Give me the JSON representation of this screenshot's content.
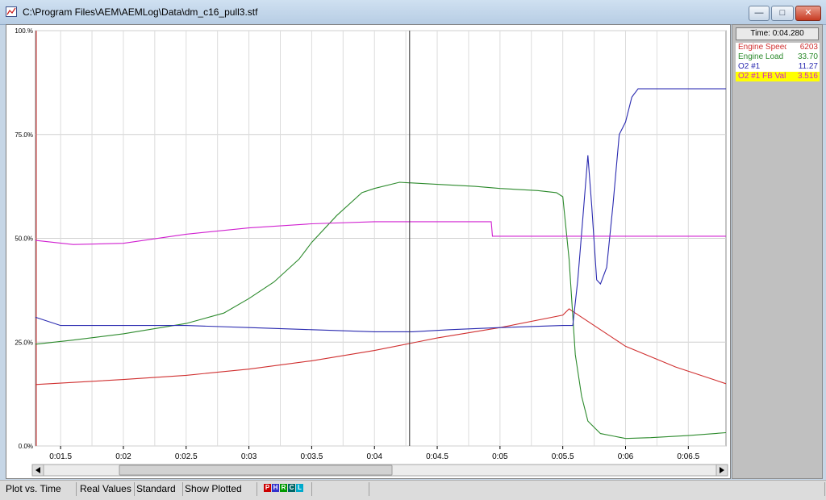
{
  "window": {
    "title": "C:\\Program Files\\AEM\\AEMLog\\Data\\dm_c16_pull3.stf"
  },
  "window_controls": {
    "minimize": "—",
    "maximize": "□",
    "close": "✕"
  },
  "chart_data": {
    "type": "line",
    "y_ticks": [
      "100.%",
      "75.0%",
      "50.0%",
      "25.0%",
      "0.0%"
    ],
    "x_ticks": [
      "0:01.5",
      "0:02",
      "0:02.5",
      "0:03",
      "0:03.5",
      "0:04",
      "0:04.5",
      "0:05",
      "0:05.5",
      "0:06",
      "0:06.5"
    ],
    "ylim": [
      0,
      100
    ],
    "xlim": [
      1.3,
      6.8
    ],
    "cursor_time": 4.28,
    "grid": true,
    "series": [
      {
        "name": "Engine Speed",
        "color": "#d03030",
        "x": [
          1.3,
          2.0,
          2.5,
          3.0,
          3.5,
          4.0,
          4.5,
          5.0,
          5.5,
          5.55,
          5.6,
          5.8,
          6.0,
          6.4,
          6.8
        ],
        "values": [
          14.8,
          16,
          17,
          18.5,
          20.5,
          23,
          26,
          28.5,
          31.5,
          33,
          32,
          28,
          24,
          19,
          15
        ]
      },
      {
        "name": "Engine Load",
        "color": "#2c8a2c",
        "x": [
          1.3,
          1.6,
          2.0,
          2.5,
          2.8,
          3.0,
          3.2,
          3.4,
          3.5,
          3.7,
          3.9,
          4.0,
          4.2,
          4.5,
          4.8,
          5.0,
          5.3,
          5.45,
          5.5,
          5.55,
          5.6,
          5.65,
          5.7,
          5.8,
          6.0,
          6.2,
          6.5,
          6.8
        ],
        "values": [
          24.5,
          25.5,
          27,
          29.5,
          32,
          35.5,
          39.5,
          45,
          49,
          55.5,
          61,
          62,
          63.5,
          63,
          62.5,
          62,
          61.5,
          61,
          60,
          45,
          22,
          12,
          6,
          3,
          1.8,
          2,
          2.5,
          3.2
        ]
      },
      {
        "name": "O2 #1",
        "color": "#2a2ab0",
        "x": [
          1.3,
          1.5,
          2.0,
          2.5,
          3.0,
          3.5,
          4.0,
          4.3,
          4.6,
          5.0,
          5.5,
          5.58,
          5.62,
          5.66,
          5.7,
          5.73,
          5.77,
          5.8,
          5.85,
          5.9,
          5.95,
          6.0,
          6.05,
          6.1,
          6.8
        ],
        "values": [
          31,
          29,
          29,
          29,
          28.5,
          28,
          27.5,
          27.5,
          28,
          28.5,
          29,
          29,
          40,
          55,
          70,
          58,
          40,
          39,
          43,
          58,
          75,
          78,
          84,
          86,
          86
        ]
      },
      {
        "name": "O2 #1 FB Val",
        "color": "#d020d0",
        "x": [
          1.3,
          1.6,
          2.0,
          2.5,
          3.0,
          3.5,
          4.0,
          4.5,
          4.93,
          4.94,
          5.2,
          5.5,
          6.0,
          6.8
        ],
        "values": [
          49.5,
          48.5,
          48.8,
          51,
          52.5,
          53.5,
          54,
          54,
          54,
          50.5,
          50.5,
          50.5,
          50.5,
          50.5
        ]
      }
    ]
  },
  "right_panel": {
    "time_readout": "Time: 0:04.280",
    "legend": [
      {
        "name": "Engine Speed",
        "value": "6203",
        "color": "#d03030",
        "selected": false
      },
      {
        "name": "Engine Load",
        "value": "33.70",
        "color": "#2c8a2c",
        "selected": false
      },
      {
        "name": "O2 #1",
        "value": "11.27",
        "color": "#2a2ab0",
        "selected": false
      },
      {
        "name": "O2 #1 FB Val",
        "value": "3.516",
        "color": "#d020d0",
        "selected": true
      }
    ]
  },
  "statusbar": {
    "mode": "Plot vs. Time",
    "values_mode": "Real Values",
    "view": "Standard",
    "show": "Show Plotted",
    "palette": [
      "P",
      "H",
      "R",
      "C",
      "L"
    ],
    "palette_colors": [
      "#cc0000",
      "#3333cc",
      "#009900",
      "#006666",
      "#00aacc"
    ]
  }
}
